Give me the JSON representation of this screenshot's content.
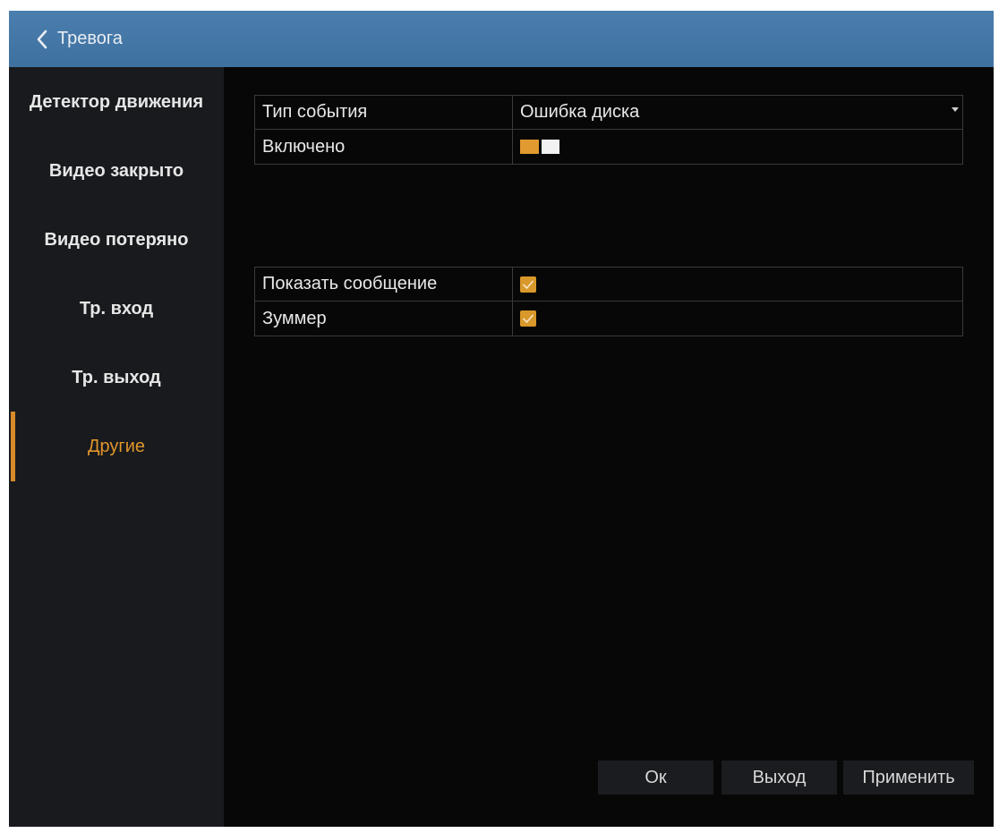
{
  "window": {
    "title": "Тревога"
  },
  "sidebar": {
    "items": [
      {
        "label": "Детектор движения"
      },
      {
        "label": "Видео закрыто"
      },
      {
        "label": "Видео потеряно"
      },
      {
        "label": "Тр. вход"
      },
      {
        "label": "Тр. выход"
      },
      {
        "label": "Другие",
        "active": true
      }
    ]
  },
  "settings": {
    "event_type_label": "Тип события",
    "event_type_value": "Ошибка диска",
    "enabled_label": "Включено",
    "enabled_value": true,
    "show_message_label": "Показать сообщение",
    "show_message_checked": true,
    "buzzer_label": "Зуммер",
    "buzzer_checked": true
  },
  "buttons": {
    "ok_label": "Ок",
    "exit_label": "Выход",
    "apply_label": "Применить"
  },
  "colors": {
    "accent": "#e09a2f",
    "titlebar": "#4177a6",
    "sidebar_bg": "#181a1e",
    "content_bg": "#070707"
  },
  "icons": {
    "back": "chevron-left-icon",
    "dropdown": "caret-down-icon",
    "check": "checkmark-icon"
  }
}
